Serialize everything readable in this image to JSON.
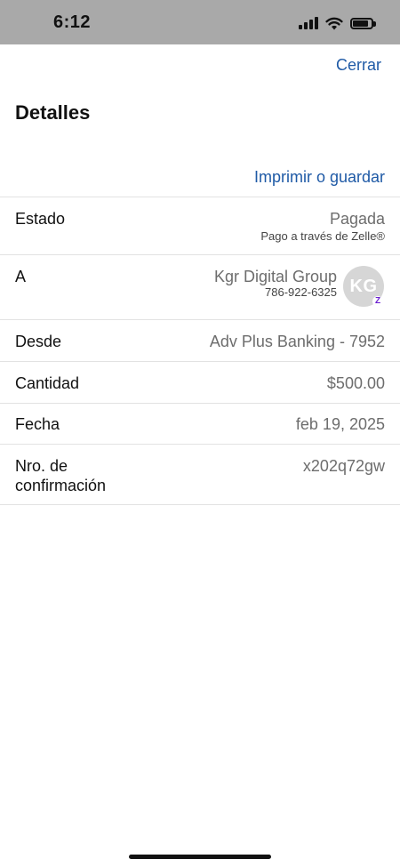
{
  "status_bar": {
    "time": "6:12"
  },
  "header": {
    "close_label": "Cerrar",
    "title": "Detalles",
    "print_label": "Imprimir o guardar"
  },
  "details": {
    "status": {
      "label": "Estado",
      "value": "Pagada",
      "sub": "Pago a través de Zelle®"
    },
    "recipient": {
      "label": "A",
      "name": "Kgr Digital Group",
      "phone": "786-922-6325",
      "initials": "KG",
      "badge": "Z"
    },
    "from": {
      "label": "Desde",
      "value": "Adv Plus Banking - 7952"
    },
    "amount": {
      "label": "Cantidad",
      "value": "$500.00"
    },
    "date": {
      "label": "Fecha",
      "value": "feb 19, 2025"
    },
    "confirmation": {
      "label_line1": "Nro. de",
      "label_line2": "confirmación",
      "value": "x202q72gw"
    }
  },
  "colors": {
    "link": "#1f5aa6",
    "status_bar_bg": "#a9a9a9",
    "zelle_purple": "#6b1fd0"
  },
  "icons": [
    "cellular-signal-icon",
    "wifi-icon",
    "battery-icon",
    "zelle-badge-icon"
  ]
}
